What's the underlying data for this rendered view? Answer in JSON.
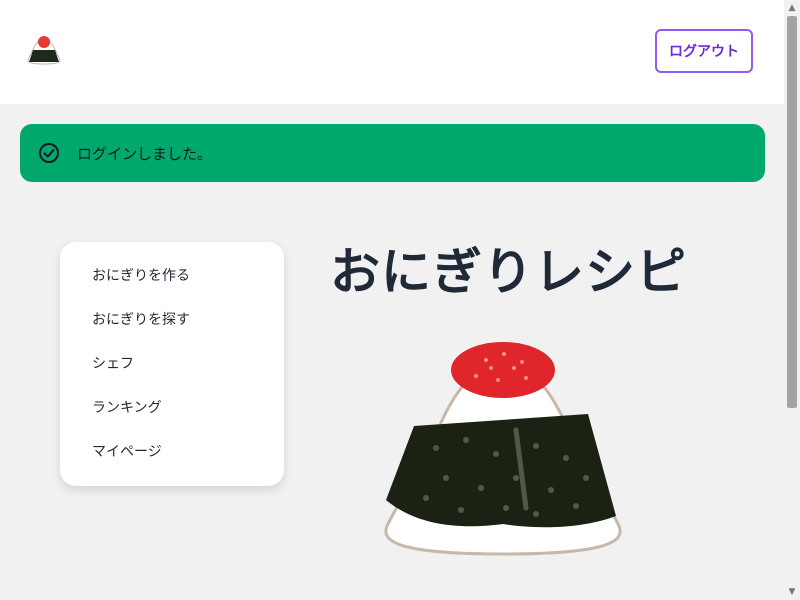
{
  "header": {
    "logo_icon": "onigiri-logo-icon",
    "logout_label": "ログアウト"
  },
  "alert": {
    "icon": "check-circle-icon",
    "message": "ログインしました。",
    "color": "#00a86b"
  },
  "menu": {
    "items": [
      {
        "label": "おにぎりを作る"
      },
      {
        "label": "おにぎりを探す"
      },
      {
        "label": "シェフ"
      },
      {
        "label": "ランキング"
      },
      {
        "label": "マイページ"
      }
    ]
  },
  "main": {
    "title": "おにぎりレシピ",
    "hero_image": "onigiri-illustration"
  },
  "colors": {
    "accent": "#8b5cf6",
    "success": "#00a86b",
    "background": "#f1f1f2"
  }
}
